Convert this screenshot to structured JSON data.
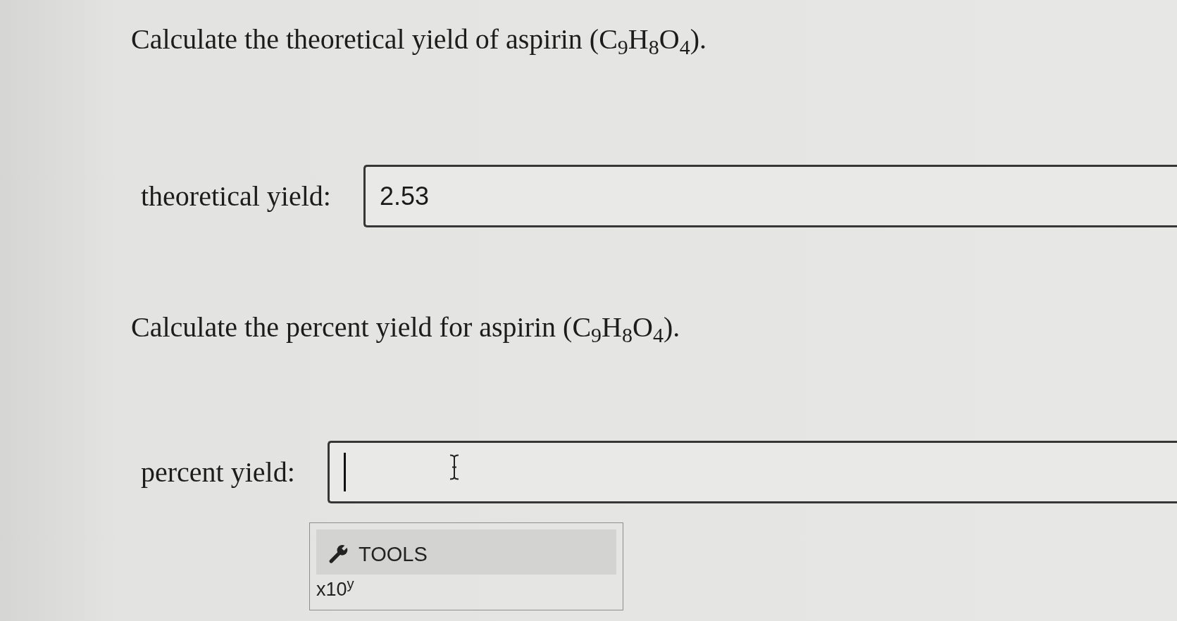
{
  "questions": [
    {
      "prompt": "Calculate the theoretical yield of aspirin (C$_{9}$H$_{8}$O$_{4}$).",
      "answer": {
        "label": "theoretical yield:",
        "value": "2.53",
        "focused": false,
        "hovered": false
      }
    },
    {
      "prompt": "Calculate the percent yield for aspirin (C$_{9}$H$_{8}$O$_{4}$).",
      "answer": {
        "label": "percent yield:",
        "focused": true,
        "hovered": true
      }
    }
  ],
  "tools": {
    "label": "TOOLS",
    "keys": [
      "x10$^{y}$"
    ]
  }
}
